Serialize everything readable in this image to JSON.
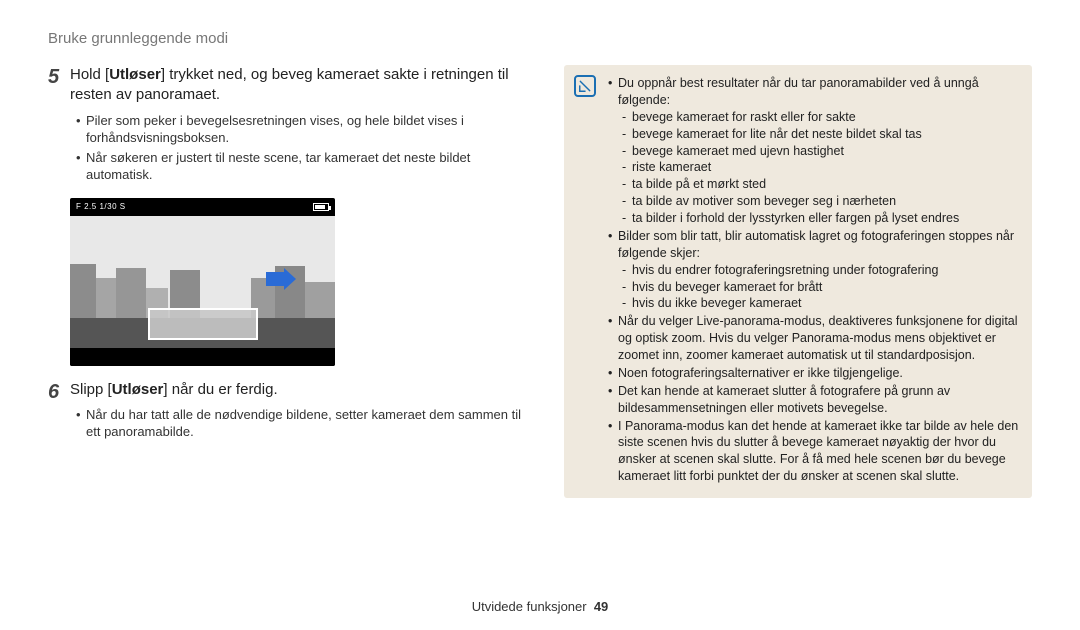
{
  "header": {
    "title": "Bruke grunnleggende modi"
  },
  "steps": {
    "s5": {
      "num": "5",
      "text_pre": "Hold [",
      "text_bold": "Utløser",
      "text_post": "] trykket ned, og beveg kameraet sakte i retningen til resten av panoramaet.",
      "bullets": [
        "Piler som peker i bevegelsesretningen vises, og hele bildet vises i forhåndsvisningsboksen.",
        "Når søkeren er justert til neste scene, tar kameraet det neste bildet automatisk."
      ]
    },
    "s6": {
      "num": "6",
      "text_pre": "Slipp [",
      "text_bold": "Utløser",
      "text_post": "] når du er ferdig.",
      "bullets": [
        "Når du har tatt alle de nødvendige bildene, setter kameraet dem sammen til ett panoramabilde."
      ]
    }
  },
  "camera": {
    "exposure": "F 2.5 1/30 S"
  },
  "tip": {
    "items": [
      {
        "text": "Du oppnår best resultater når du tar panoramabilder ved å unngå følgende:",
        "sub": [
          "bevege kameraet for raskt eller for sakte",
          "bevege kameraet for lite når det neste bildet skal tas",
          "bevege kameraet med ujevn hastighet",
          "riste kameraet",
          "ta bilde på et mørkt sted",
          "ta bilde av motiver som beveger seg i nærheten",
          "ta bilder i forhold der lysstyrken eller fargen på lyset endres"
        ]
      },
      {
        "text": "Bilder som blir tatt, blir automatisk lagret og fotograferingen stoppes når følgende skjer:",
        "sub": [
          "hvis du endrer fotograferingsretning under fotografering",
          "hvis du beveger kameraet for brått",
          "hvis du ikke beveger kameraet"
        ]
      },
      {
        "text": "Når du velger Live-panorama-modus, deaktiveres funksjonene for digital og optisk zoom. Hvis du velger Panorama-modus mens objektivet er zoomet inn, zoomer kameraet automatisk ut til standardposisjon."
      },
      {
        "text": "Noen fotograferingsalternativer er ikke tilgjengelige."
      },
      {
        "text": "Det kan hende at kameraet slutter å fotografere på grunn av bildesammensetningen eller motivets bevegelse."
      },
      {
        "text": "I Panorama-modus kan det hende at kameraet ikke tar bilde av hele den siste scenen hvis du slutter å bevege kameraet nøyaktig der hvor du ønsker at scenen skal slutte. For å få med hele scenen bør du bevege kameraet litt forbi punktet der du ønsker at scenen skal slutte."
      }
    ]
  },
  "footer": {
    "section": "Utvidede funksjoner",
    "page": "49"
  }
}
